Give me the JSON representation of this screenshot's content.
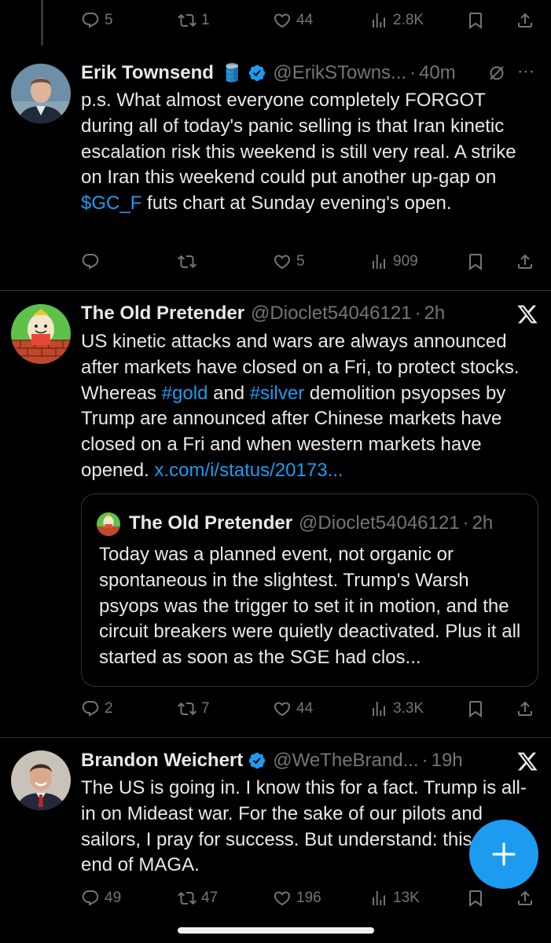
{
  "top_actions": {
    "replies": "5",
    "reposts": "1",
    "likes": "44",
    "views": "2.8K"
  },
  "tweets": [
    {
      "name": "Erik Townsend",
      "emoji": "🛢️",
      "handle": "@ErikSTowns...",
      "sep": "·",
      "time": "40m",
      "text_before": "p.s. What almost everyone completely FORGOT during all of today's panic selling is that Iran kinetic escalation risk this weekend is still very real. A strike on Iran this weekend could put another up-gap on ",
      "cashtag": "$GC_F",
      "text_after": " futs chart at Sunday evening's open.",
      "actions": {
        "replies": "",
        "reposts": "",
        "likes": "5",
        "views": "909"
      }
    },
    {
      "name": "The Old Pretender",
      "handle": "@Dioclet54046121",
      "sep": "·",
      "time": "2h",
      "text_a": "US kinetic attacks and wars are always announced after markets have closed on a Fri, to protect stocks. Whereas ",
      "hashtag1": "#gold",
      "text_b": " and ",
      "hashtag2": "#silver",
      "text_c": " demolition psyopses by Trump are announced after Chinese markets have closed on a Fri and when western markets have opened. ",
      "link": "x.com/i/status/20173...",
      "quote": {
        "name": "The Old Pretender",
        "handle": "@Dioclet54046121",
        "sep": "·",
        "time": "2h",
        "text": "Today was a planned event, not organic or spontaneous in the slightest. Trump's Warsh psyops was the trigger to set it in motion, and the circuit breakers were quietly deactivated. Plus it all started as soon as the SGE had clos..."
      },
      "actions": {
        "replies": "2",
        "reposts": "7",
        "likes": "44",
        "views": "3.3K"
      }
    },
    {
      "name": "Brandon Weichert",
      "handle": "@WeTheBrand...",
      "sep": "·",
      "time": "19h",
      "text": "The US is going in. I know this for a fact. Trump is all-in on Mideast war. For the sake of our pilots and sailors, I pray for success. But understand: this is the end of MAGA.",
      "actions": {
        "replies": "49",
        "reposts": "47",
        "likes": "196",
        "views": "13K"
      }
    }
  ],
  "colors": {
    "accent": "#1d9bf0",
    "muted": "#71767b",
    "text": "#e7e9ea",
    "divider": "#2f3336"
  }
}
